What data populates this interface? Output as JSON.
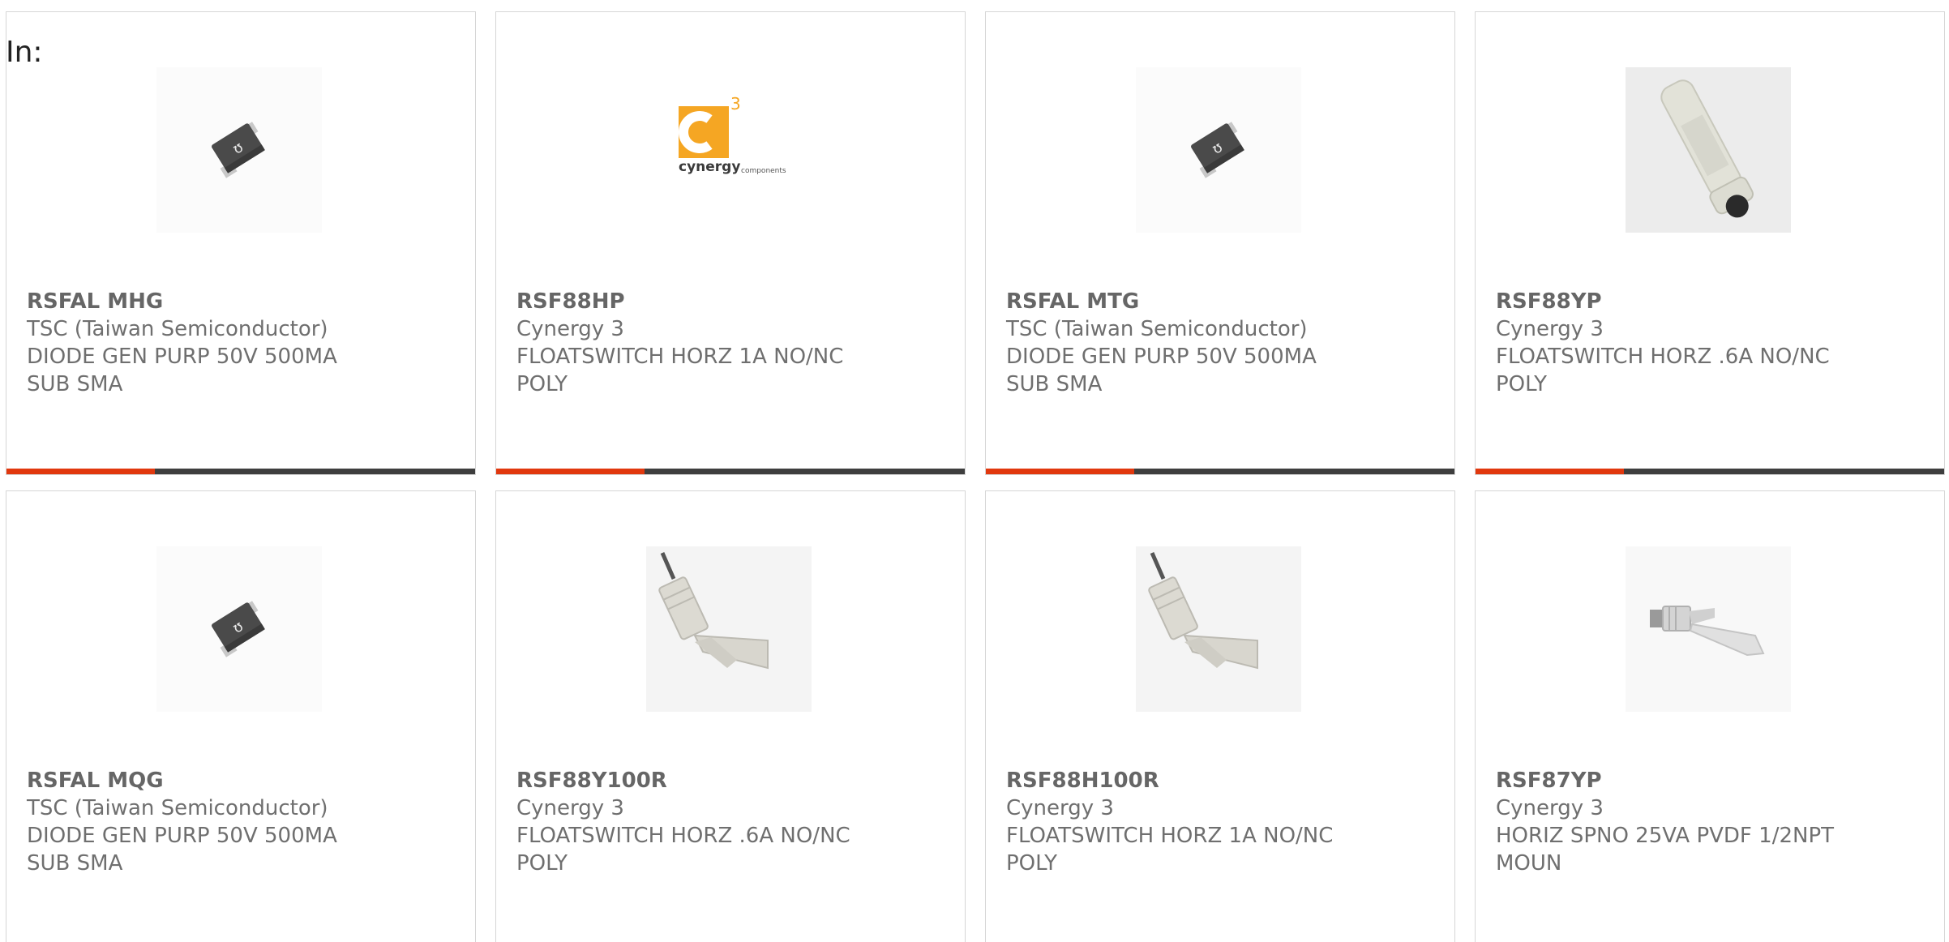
{
  "header": {
    "in_label": "In:"
  },
  "products": [
    {
      "part": "RSFAL MHG",
      "manufacturer": "TSC (Taiwan Semiconductor)",
      "description_line1": "DIODE GEN PURP 50V 500MA",
      "description_line2": "SUB SMA",
      "image": "diode-smd-icon"
    },
    {
      "part": "RSF88HP",
      "manufacturer": "Cynergy 3",
      "description_line1": "FLOATSWITCH HORZ 1A NO/NC",
      "description_line2": "POLY",
      "image": "cynergy3-logo",
      "logo_text": "cynergy",
      "logo_sup": "3",
      "logo_sub": "components"
    },
    {
      "part": "RSFAL MTG",
      "manufacturer": "TSC (Taiwan Semiconductor)",
      "description_line1": "DIODE GEN PURP 50V 500MA",
      "description_line2": "SUB SMA",
      "image": "diode-smd-icon"
    },
    {
      "part": "RSF88YP",
      "manufacturer": "Cynergy 3",
      "description_line1": "FLOATSWITCH HORZ .6A NO/NC",
      "description_line2": "POLY",
      "image": "float-switch-cylinder-icon"
    },
    {
      "part": "RSFAL MQG",
      "manufacturer": "TSC (Taiwan Semiconductor)",
      "description_line1": "DIODE GEN PURP 50V 500MA",
      "description_line2": "SUB SMA",
      "image": "diode-smd-icon"
    },
    {
      "part": "RSF88Y100R",
      "manufacturer": "Cynergy 3",
      "description_line1": "FLOATSWITCH HORZ .6A NO/NC",
      "description_line2": "POLY",
      "image": "float-switch-horizontal-icon"
    },
    {
      "part": "RSF88H100R",
      "manufacturer": "Cynergy 3",
      "description_line1": "FLOATSWITCH HORZ 1A NO/NC",
      "description_line2": "POLY",
      "image": "float-switch-horizontal-icon"
    },
    {
      "part": "RSF87YP",
      "manufacturer": "Cynergy 3",
      "description_line1": "HORIZ SPNO 25VA PVDF 1/2NPT",
      "description_line2": "MOUN",
      "image": "float-switch-small-icon"
    }
  ],
  "colors": {
    "accent": "#e1380e",
    "bar": "#3e3e3e",
    "logo_orange": "#f5a623"
  }
}
